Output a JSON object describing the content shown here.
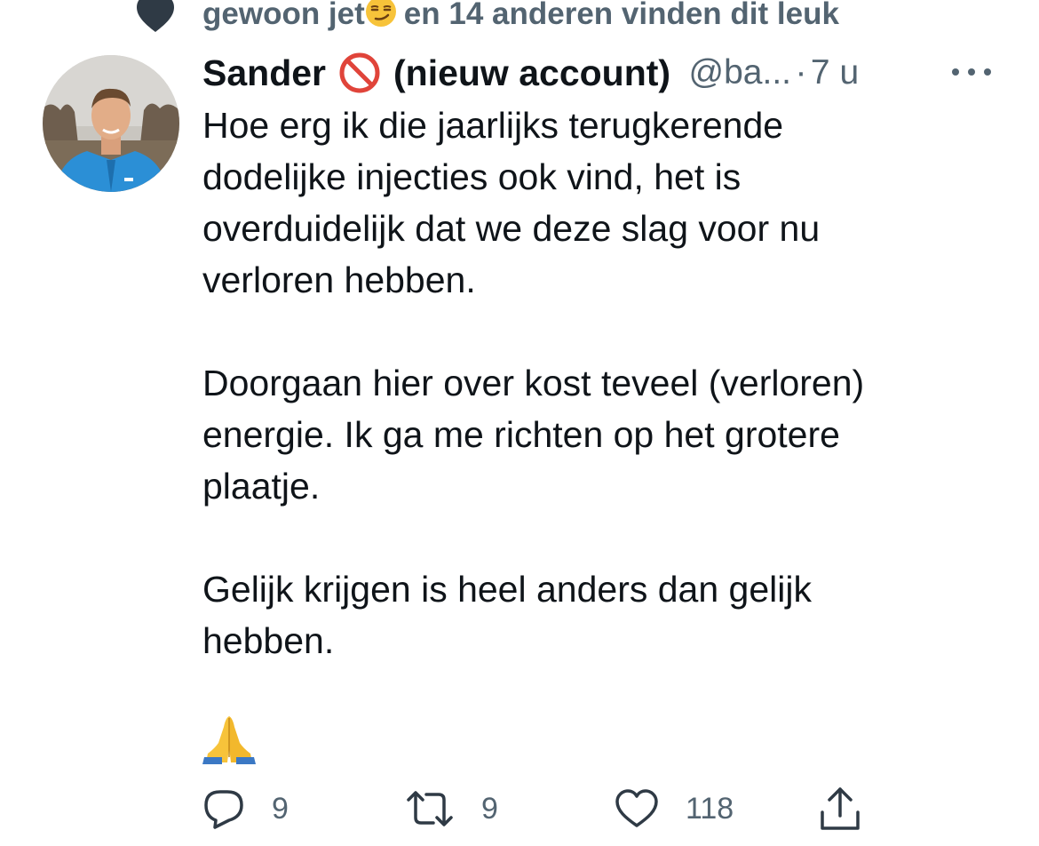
{
  "context": {
    "text_prefix": "gewoon jet",
    "text_suffix": "en 14 anderen vinden dit leuk",
    "icon": "heart-filled-icon",
    "emoji": "smirking-face"
  },
  "tweet": {
    "author_name": "Sander",
    "author_badge": "no-entry-sign",
    "author_suffix": "(nieuw account)",
    "handle": "@ba...",
    "separator": "·",
    "time": "7 u",
    "paragraphs": [
      "Hoe erg ik die jaarlijks terugkerende\ndodelijke injecties ook vind, het is\noverduidelijk dat we deze slag voor nu\nverloren hebben.",
      "Doorgaan hier over kost teveel (verloren)\nenergie. Ik ga me richten op het grotere\nplaatje.",
      "Gelijk krijgen is heel anders dan gelijk\nhebben."
    ],
    "closing_emoji": "folded-hands"
  },
  "actions": {
    "reply_count": "9",
    "retweet_count": "9",
    "like_count": "118"
  },
  "colors": {
    "text": "#0f1419",
    "secondary": "#536471",
    "no_entry_red": "#e0443a"
  }
}
